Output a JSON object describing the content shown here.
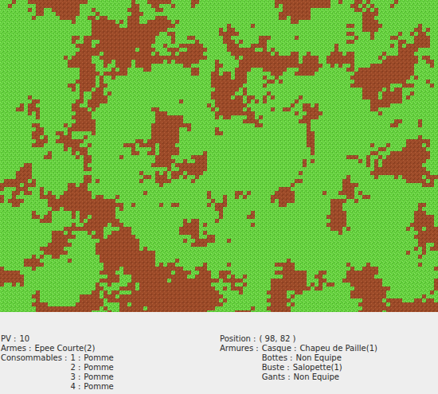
{
  "map": {
    "terrain": [
      {
        "kind": "grass",
        "color": "#63cf3c"
      },
      {
        "kind": "dirt",
        "color": "#9c4a28"
      }
    ],
    "dirt_share": 0.3,
    "seed": 98082
  },
  "status": {
    "hp": {
      "label": "PV :",
      "value": "10"
    },
    "weapons": {
      "label": "Armes :",
      "items": [
        "Epee Courte(2)"
      ]
    },
    "consumables": {
      "label": "Consommables :",
      "items": [
        {
          "slot": "1 :",
          "name": "Pomme"
        },
        {
          "slot": "2 :",
          "name": "Pomme"
        },
        {
          "slot": "3 :",
          "name": "Pomme"
        },
        {
          "slot": "4 :",
          "name": "Pomme"
        }
      ]
    },
    "position": {
      "label": "Position :",
      "value": "( 98, 82 )"
    },
    "armor": {
      "label": "Armures :",
      "items": [
        {
          "slot": "Casque :",
          "name": "Chapeu de Paille(1)"
        },
        {
          "slot": "Bottes :",
          "name": "Non Equipe"
        },
        {
          "slot": "Buste :",
          "name": "Salopette(1)"
        },
        {
          "slot": "Gants :",
          "name": "Non Equipe"
        }
      ]
    }
  }
}
